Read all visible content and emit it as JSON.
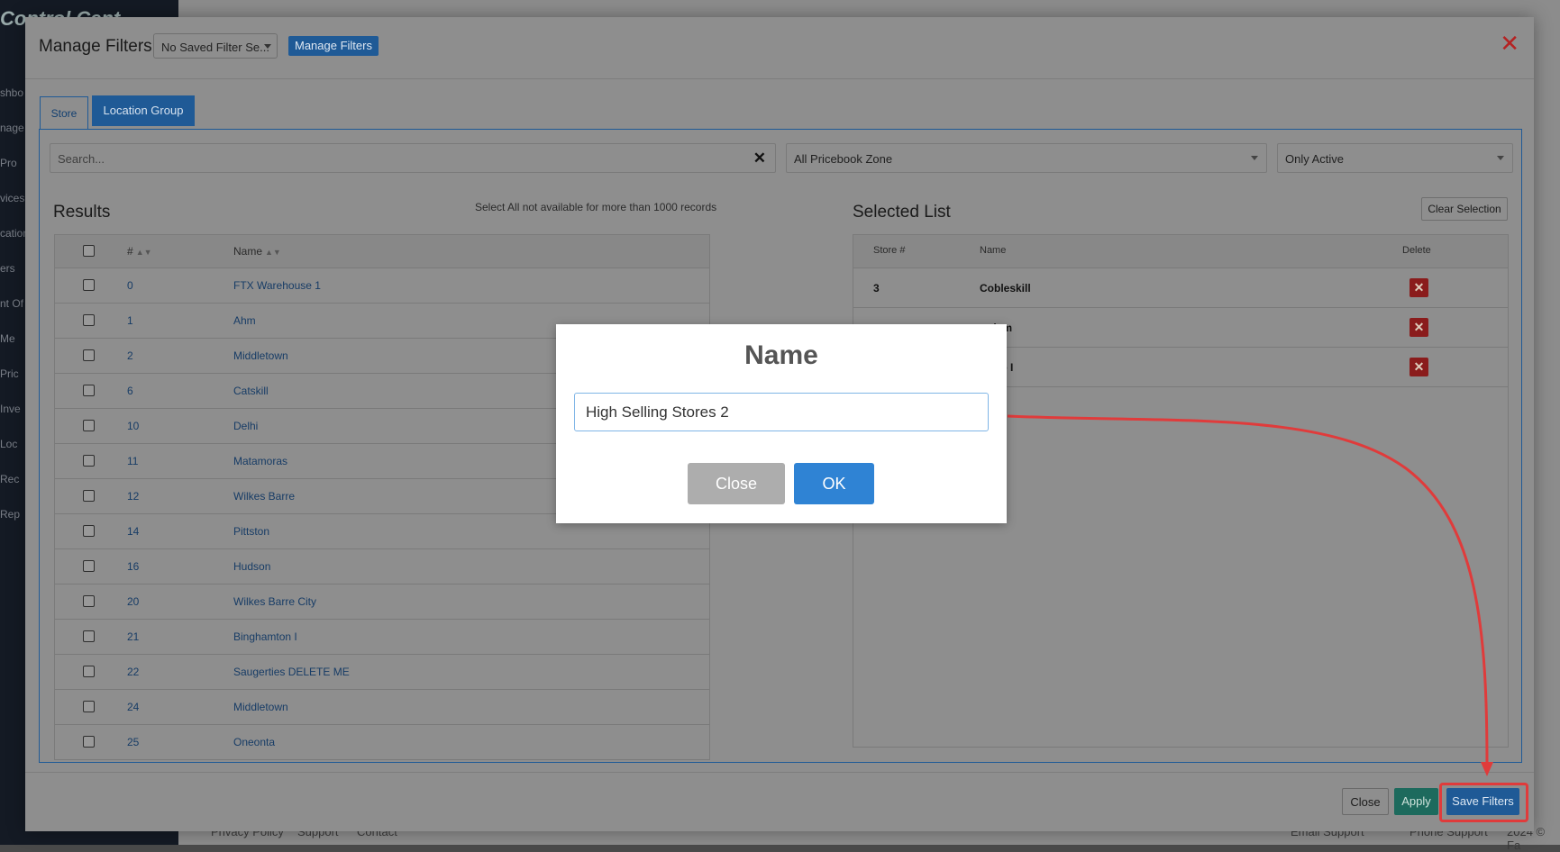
{
  "background": {
    "brand": "Control Cent",
    "nav": [
      "shbo",
      "nage",
      "Pro",
      "vices",
      "cation",
      "ers",
      "nt Of",
      "Me",
      "Pric",
      "Inve",
      "Loc",
      "Rec",
      "Rep"
    ],
    "footer": [
      "Privacy Policy",
      "Support",
      "Contact",
      "Email Support",
      "Phone Support",
      "2024 © Fa"
    ]
  },
  "modal": {
    "title": "Manage Filters",
    "saved_filter": "No Saved Filter Se...",
    "manage_button": "Manage Filters",
    "tabs": [
      {
        "label": "Store"
      },
      {
        "label": "Location Group"
      }
    ],
    "search_placeholder": "Search...",
    "zone": "All Pricebook Zone",
    "status": "Only Active",
    "results_title": "Results",
    "results_note": "Select All not available for more than 1000 records",
    "results_headers": {
      "num": "#",
      "name": "Name"
    },
    "results": [
      {
        "num": "0",
        "name": "FTX Warehouse 1"
      },
      {
        "num": "1",
        "name": "Ahm"
      },
      {
        "num": "2",
        "name": "Middletown"
      },
      {
        "num": "6",
        "name": "Catskill"
      },
      {
        "num": "10",
        "name": "Delhi"
      },
      {
        "num": "11",
        "name": "Matamoras"
      },
      {
        "num": "12",
        "name": "Wilkes Barre"
      },
      {
        "num": "14",
        "name": "Pittston"
      },
      {
        "num": "16",
        "name": "Hudson"
      },
      {
        "num": "20",
        "name": "Wilkes Barre City"
      },
      {
        "num": "21",
        "name": "Binghamton I"
      },
      {
        "num": "22",
        "name": "Saugerties DELETE ME"
      },
      {
        "num": "24",
        "name": "Middletown"
      },
      {
        "num": "25",
        "name": "Oneonta"
      }
    ],
    "selected_title": "Selected List",
    "clear_button": "Clear Selection",
    "selected_headers": {
      "store": "Store #",
      "name": "Name",
      "delete": "Delete"
    },
    "selected": [
      {
        "store": "3",
        "name": "Cobleskill"
      },
      {
        "store": "",
        "name": "erdam"
      },
      {
        "store": "",
        "name": "icello I"
      }
    ],
    "footer": {
      "close": "Close",
      "apply": "Apply",
      "save": "Save Filters"
    }
  },
  "dialog": {
    "title": "Name",
    "input_value": "High Selling Stores 2",
    "close": "Close",
    "ok": "OK"
  },
  "colors": {
    "annotation": "#e03b3b",
    "primary": "#2f83d4",
    "danger": "#8a1c1c"
  }
}
